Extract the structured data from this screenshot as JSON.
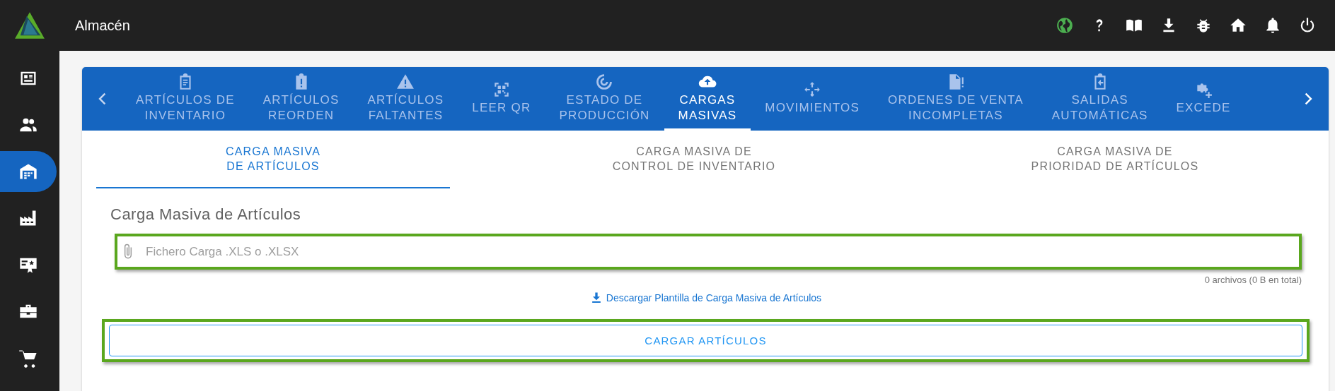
{
  "app": {
    "title": "Almacén"
  },
  "sidebar": {
    "items": [
      {
        "selected": false
      },
      {
        "selected": false
      },
      {
        "selected": true
      },
      {
        "selected": false
      },
      {
        "selected": false
      },
      {
        "selected": false
      },
      {
        "selected": false
      }
    ]
  },
  "tabs": [
    {
      "label": "ARTÍCULOS DE\nINVENTARIO",
      "selected": false
    },
    {
      "label": "ARTÍCULOS\nREORDEN",
      "selected": false
    },
    {
      "label": "ARTÍCULOS\nFALTANTES",
      "selected": false
    },
    {
      "label": "LEER QR",
      "selected": false
    },
    {
      "label": "ESTADO DE\nPRODUCCIÓN",
      "selected": false
    },
    {
      "label": "CARGAS\nMASIVAS",
      "selected": true
    },
    {
      "label": "MOVIMIENTOS",
      "selected": false
    },
    {
      "label": "ORDENES DE VENTA\nINCOMPLETAS",
      "selected": false
    },
    {
      "label": "SALIDAS\nAUTOMÁTICAS",
      "selected": false
    },
    {
      "label": "EXCEDE",
      "selected": false
    }
  ],
  "subtabs": [
    {
      "label": "CARGA MASIVA\nDE ARTÍCULOS",
      "selected": true
    },
    {
      "label": "CARGA MASIVA DE\nCONTROL DE INVENTARIO",
      "selected": false
    },
    {
      "label": "CARGA MASIVA DE\nPRIORIDAD DE ARTÍCULOS",
      "selected": false
    }
  ],
  "section_title": "Carga Masiva de Artículos",
  "file_field": {
    "placeholder": "Fichero Carga .XLS o .XLSX"
  },
  "file_count": "0 archivos (0 B en total)",
  "download_link": "Descargar Plantilla de Carga Masiva de Artículos",
  "submit_button": "CARGAR ARTÍCULOS"
}
